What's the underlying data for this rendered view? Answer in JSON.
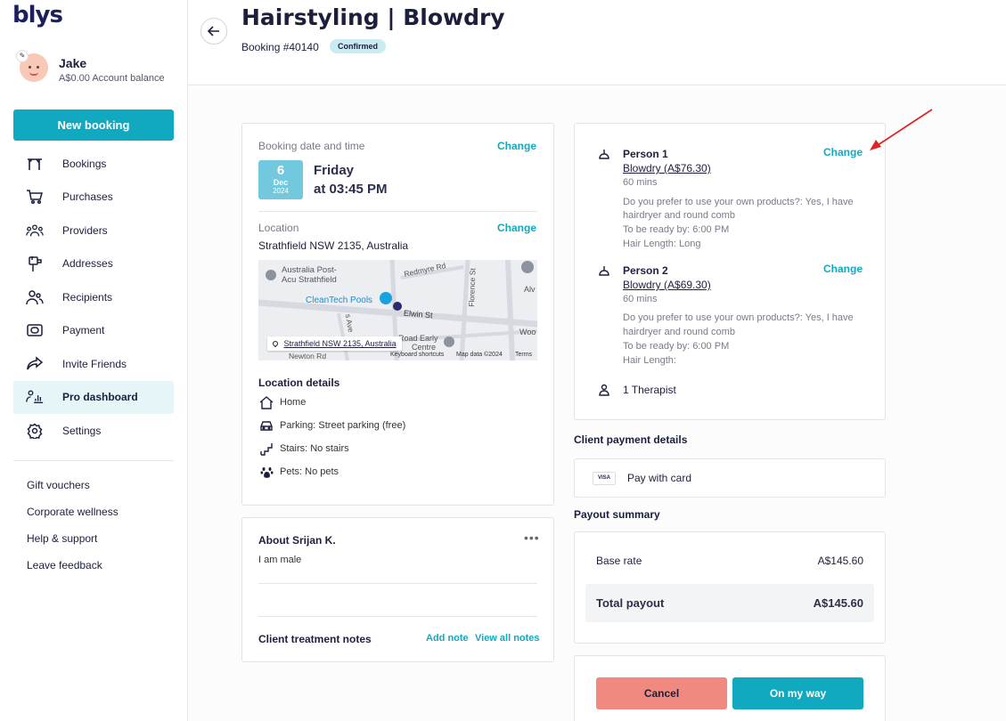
{
  "app": {
    "logo": "blys"
  },
  "profile": {
    "name": "Jake",
    "balance": "A$0.00 Account balance"
  },
  "sidebar": {
    "new_booking": "New booking",
    "items": [
      {
        "label": "Bookings",
        "icon": "bookings-icon"
      },
      {
        "label": "Purchases",
        "icon": "cart-icon"
      },
      {
        "label": "Providers",
        "icon": "providers-icon"
      },
      {
        "label": "Addresses",
        "icon": "mailbox-icon"
      },
      {
        "label": "Recipients",
        "icon": "recipients-icon"
      },
      {
        "label": "Payment",
        "icon": "payment-icon"
      },
      {
        "label": "Invite Friends",
        "icon": "share-icon"
      },
      {
        "label": "Pro dashboard",
        "icon": "pro-dashboard-icon",
        "active": true
      },
      {
        "label": "Settings",
        "icon": "gear-icon"
      }
    ],
    "links": [
      "Gift vouchers",
      "Corporate wellness",
      "Help & support",
      "Leave feedback"
    ]
  },
  "header": {
    "title": "Hairstyling | Blowdry",
    "booking_number": "Booking #40140",
    "status": "Confirmed"
  },
  "booking": {
    "date_label": "Booking date and time",
    "change": "Change",
    "day": "6",
    "month": "Dec",
    "year": "2024",
    "weekday": "Friday",
    "time": "at 03:45 PM",
    "location_label": "Location",
    "address": "Strathfield NSW 2135, Australia",
    "map": {
      "labels": [
        "Australia Post-",
        "Acu Strathfield",
        "CleanTech Pools",
        "Elwin St",
        "Redmyre Rd",
        "Florence St",
        "Alv",
        "Woo",
        "Road Early",
        "Centre",
        "s Ave",
        "Newton Rd"
      ],
      "pill": "Strathfield NSW 2135, Australia",
      "footer": [
        "Keyboard shortcuts",
        "Map data ©2024",
        "Terms"
      ]
    },
    "location_details_title": "Location details",
    "details": [
      "Home",
      "Parking: Street parking (free)",
      "Stairs: No stairs",
      "Pets: No pets"
    ]
  },
  "about": {
    "title": "About Srijan K.",
    "text": "I am male",
    "notes_title": "Client treatment notes",
    "add_note": "Add note",
    "view_all": "View all notes"
  },
  "persons": [
    {
      "name": "Person 1",
      "service": "Blowdry (A$76.30)",
      "duration": "60 mins",
      "pref1": "Do you prefer to use your own products?: Yes, I have",
      "pref2": "hairdryer and round comb",
      "ready": "To be ready by: 6:00 PM",
      "hair": "Hair Length: Long"
    },
    {
      "name": "Person 2",
      "service": "Blowdry (A$69.30)",
      "duration": "60 mins",
      "pref1": "Do you prefer to use your own products?: Yes, I have",
      "pref2": "hairdryer and round comb",
      "ready": "To be ready by: 6:00 PM",
      "hair": "Hair Length:"
    }
  ],
  "therapist": "1 Therapist",
  "payment": {
    "title": "Client payment details",
    "card_brand": "VISA",
    "method": "Pay with card"
  },
  "payout": {
    "title": "Payout summary",
    "base_label": "Base rate",
    "base_value": "A$145.60",
    "total_label": "Total payout",
    "total_value": "A$145.60"
  },
  "actions": {
    "cancel": "Cancel",
    "on_my_way": "On my way"
  },
  "colors": {
    "accent": "#10a9c0",
    "cancel": "#f08a80",
    "annotation": "#e02424"
  }
}
